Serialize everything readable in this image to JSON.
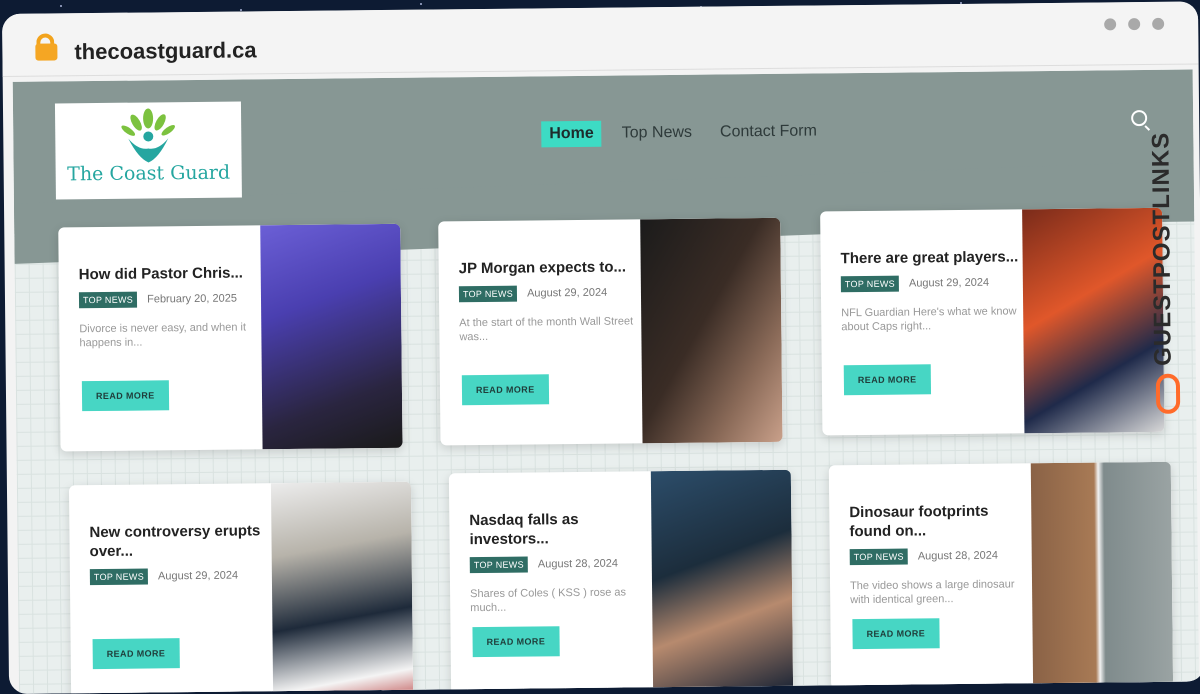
{
  "browser": {
    "url": "thecoastguard.ca"
  },
  "site": {
    "logo_text": "The Coast Guard",
    "nav": [
      "Home",
      "Top News",
      "Contact Form"
    ],
    "accent": "#3ddbc4",
    "tag_color": "#2f6d64"
  },
  "cards": [
    {
      "title": "How did Pastor Chris...",
      "tag": "TOP NEWS",
      "date": "February 20, 2025",
      "excerpt": "Divorce is never easy, and when it happens in...",
      "button": "READ MORE"
    },
    {
      "title": "JP Morgan expects to...",
      "tag": "TOP NEWS",
      "date": "August 29, 2024",
      "excerpt": "At the start of the month Wall Street was...",
      "button": "READ MORE"
    },
    {
      "title": "There are great players...",
      "tag": "TOP NEWS",
      "date": "August 29, 2024",
      "excerpt": "NFL Guardian Here's what we know about Caps right...",
      "button": "READ MORE"
    },
    {
      "title": "New controversy erupts over...",
      "tag": "TOP NEWS",
      "date": "August 29, 2024",
      "excerpt": "",
      "button": "READ MORE"
    },
    {
      "title": "Nasdaq falls as investors...",
      "tag": "TOP NEWS",
      "date": "August 28, 2024",
      "excerpt": "Shares of Coles ( KSS ) rose as much...",
      "button": "READ MORE"
    },
    {
      "title": "Dinosaur footprints found on...",
      "tag": "TOP NEWS",
      "date": "August 28, 2024",
      "excerpt": "The video shows a large dinosaur with identical green...",
      "button": "READ MORE"
    }
  ],
  "watermark": {
    "text": "GUESTPOSTLINKS",
    "icon": "link-icon"
  }
}
